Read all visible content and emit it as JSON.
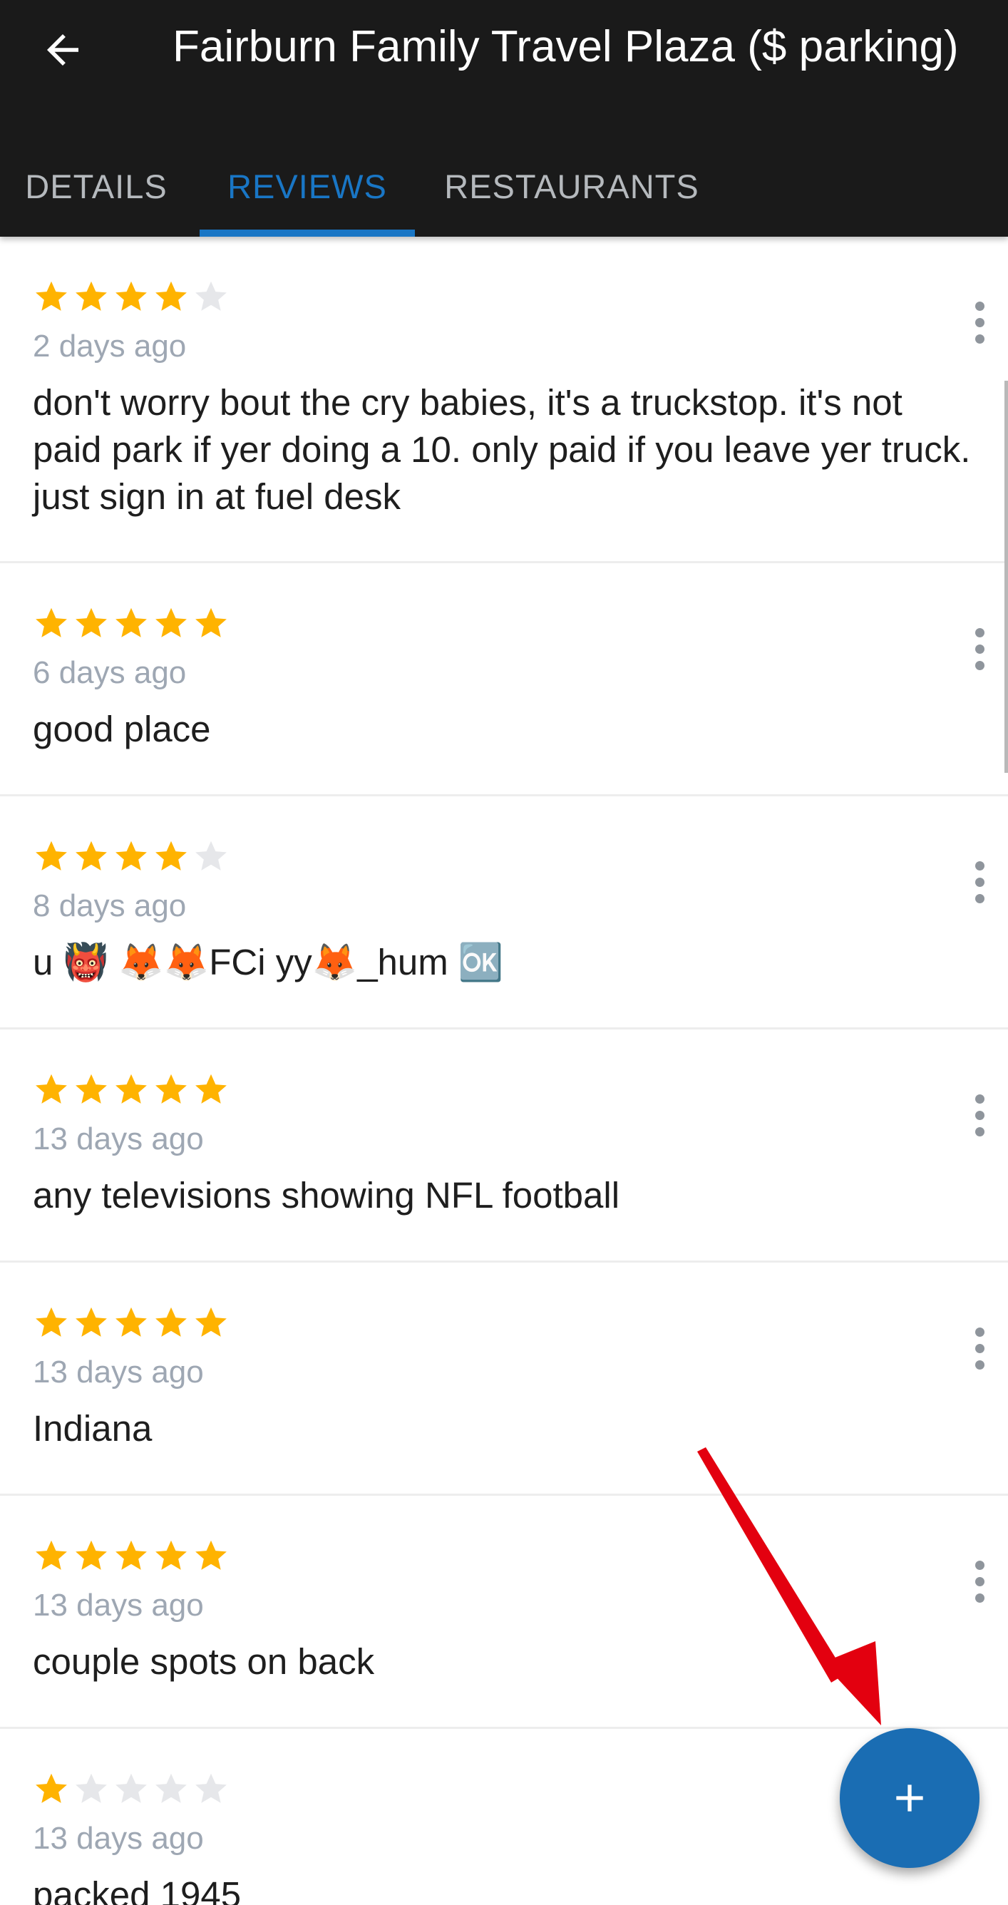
{
  "header": {
    "back_icon": "arrow-left-icon",
    "title": "Fairburn Family Travel Plaza ($ parking)"
  },
  "tabs": [
    {
      "label": "DETAILS",
      "selected": false
    },
    {
      "label": "REVIEWS",
      "selected": true
    },
    {
      "label": "RESTAURANTS",
      "selected": false
    }
  ],
  "colors": {
    "header_bg": "#1a1a1a",
    "accent": "#1976c5",
    "star_filled": "#ffb300",
    "star_empty": "#e6e7ea",
    "fab": "#1a6db3",
    "annotation_arrow": "#e3000f"
  },
  "reviews": [
    {
      "rating": 4,
      "date": "2 days ago",
      "text": "don't worry bout the cry babies, it's a truckstop. it's not paid park if yer doing a 10. only paid if you leave yer truck. just sign in at fuel desk"
    },
    {
      "rating": 5,
      "date": "6 days ago",
      "text": "good place"
    },
    {
      "rating": 4,
      "date": "8 days ago",
      "text": "u 👹 🦊🦊FCi yy🦊_hum 🆗"
    },
    {
      "rating": 5,
      "date": "13 days ago",
      "text": "any televisions showing NFL football"
    },
    {
      "rating": 5,
      "date": "13 days ago",
      "text": "Indiana"
    },
    {
      "rating": 5,
      "date": "13 days ago",
      "text": "couple spots on back"
    },
    {
      "rating": 1,
      "date": "13 days ago",
      "text": "packed 1945"
    }
  ],
  "fab": {
    "icon": "plus-icon"
  }
}
